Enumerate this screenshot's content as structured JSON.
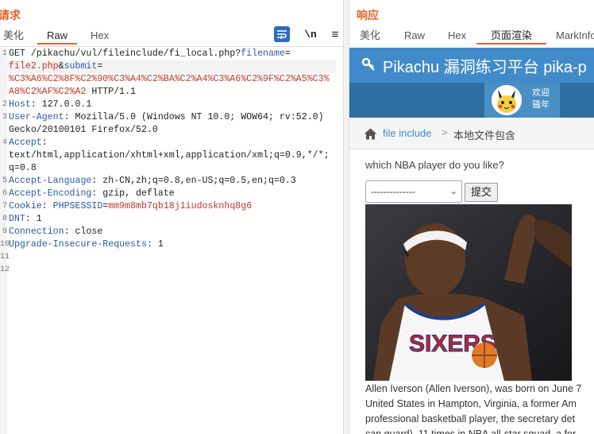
{
  "request": {
    "title": "请求",
    "tabs": [
      "美化",
      "Raw",
      "Hex"
    ],
    "active_tab": "Raw",
    "tools": {
      "newline_label": "\\n"
    },
    "line_numbers": [
      "1",
      "",
      "",
      "",
      "2",
      "3",
      "",
      "4",
      "",
      "",
      "5",
      "6",
      "7",
      "8",
      "9",
      "10",
      "11",
      "12"
    ],
    "lines": {
      "l1": "GET /pikachu/vul/fileinclude/fi_local.php?",
      "l1_key1": "filename",
      "l1_eq1": "=",
      "l1b_val": "file2.php",
      "l1b_amp": "&",
      "l1b_key2": "submit",
      "l1b_eq2": "=",
      "l1c_val": "%C3%A6%C2%8F%C2%90%C3%A4%C2%BA%C2%A4%C3%A6%C2%9F%C2%A5%C3%",
      "l1d_val": "A8%C2%AF%C2%A2",
      "l1d_rest": " HTTP/1.1",
      "host_key": "Host",
      "host_val": ": 127.0.0.1",
      "ua_key": "User-Agent",
      "ua_val": ": Mozilla/5.0 (Windows NT 10.0; WOW64; rv:52.0)",
      "ua_val2": "Gecko/20100101 Firefox/52.0",
      "accept_key": "Accept",
      "accept_val": ":",
      "accept_val2": "text/html,application/xhtml+xml,application/xml;q=0.9,*/*;",
      "accept_val3": "q=0.8",
      "al_key": "Accept-Language",
      "al_val": ": zh-CN,zh;q=0.8,en-US;q=0.5,en;q=0.3",
      "ae_key": "Accept-Encoding",
      "ae_val": ": gzip, deflate",
      "cookie_key": "Cookie",
      "cookie_sep": ": ",
      "cookie_name": "PHPSESSID",
      "cookie_eq": "=",
      "cookie_val": "mm9m8mb7qb18j1iudosknhq8g6",
      "dnt_key": "DNT",
      "dnt_val": ": 1",
      "conn_key": "Connection",
      "conn_val": ": close",
      "uir_key": "Upgrade-Insecure-Requests",
      "uir_val": ": 1"
    }
  },
  "response": {
    "title": "响应",
    "tabs": [
      "美化",
      "Raw",
      "Hex",
      "页面渲染",
      "MarkInfo"
    ],
    "active_tab": "页面渲染",
    "site_title": "Pikachu 漏洞练习平台 pika-p",
    "welcome_lines": [
      "欢迎",
      "骚年"
    ],
    "breadcrumb_link": "file include",
    "breadcrumb_sep": ">",
    "breadcrumb_current": "本地文件包含",
    "question": "which NBA player do you like?",
    "select_value": "--------------",
    "submit_label": "提交",
    "bio_lines": [
      "Allen Iverson (Allen Iverson), was born on June 7",
      "United States in Hampton, Virginia, a former Am",
      "professional basketball player, the secretary det",
      "can guard), 11 times in NBA all-star squad, a for"
    ],
    "jersey_text": "SIXERS"
  },
  "colors": {
    "accent": "#e8632a",
    "header_blue": "#428bca",
    "header_dark": "#2e6fa3",
    "key_blue": "#2a5aa8",
    "value_red": "#c0392b"
  },
  "icons": {
    "wrap": "wrap-lines-icon",
    "menu": "hamburger-menu-icon",
    "key": "key-icon",
    "home": "home-icon",
    "avatar": "pikachu-avatar-icon",
    "chevron": "chevron-down-icon"
  }
}
